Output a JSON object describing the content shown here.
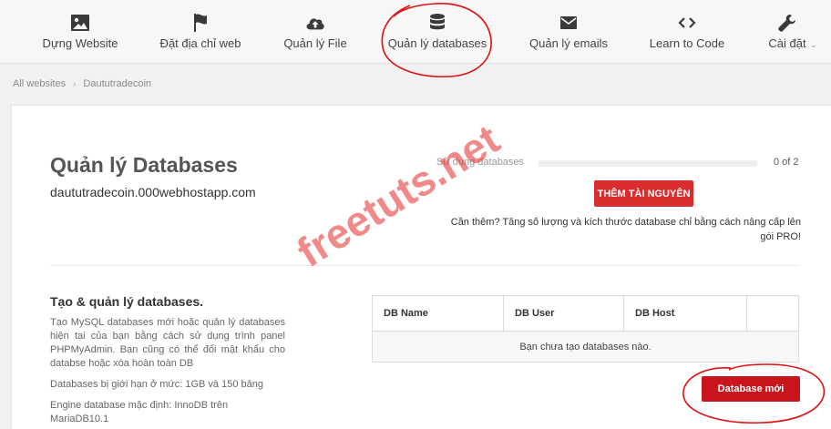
{
  "nav": {
    "items": [
      {
        "label": "Dựng Website",
        "icon": "image-icon"
      },
      {
        "label": "Đặt địa chỉ web",
        "icon": "flag-icon"
      },
      {
        "label": "Quản lý File",
        "icon": "cloud-upload-icon"
      },
      {
        "label": "Quản lý databases",
        "icon": "database-icon"
      },
      {
        "label": "Quản lý emails",
        "icon": "envelope-icon"
      },
      {
        "label": "Learn to Code",
        "icon": "code-icon"
      },
      {
        "label": "Cài đặt",
        "icon": "wrench-icon"
      }
    ],
    "caret": "⌄"
  },
  "breadcrumb": {
    "root": "All websites",
    "separator": "›",
    "current": "Daututradecoin"
  },
  "main": {
    "title": "Quản lý Databases",
    "site": "daututradecoin.000webhostapp.com",
    "usage_label": "Sử dụng databases",
    "usage_count": "0 of 2",
    "usage_fraction": 0,
    "more_button": "THÊM TÀI NGUYÊN",
    "upgrade_text": "Cần thêm? Tăng số lượng và kích thước database chỉ bằng cách nâng cấp lên gói PRO!"
  },
  "section": {
    "title": "Tạo & quản lý databases.",
    "desc": "Tạo MySQL databases mới hoặc quản lý databases hiện tại của bạn bằng cách sử dụng trình panel PHPMyAdmin. Bạn cũng có thể đổi mật khẩu cho databse hoặc xóa hoàn toàn DB",
    "limit": "Databases bị giới hạn ở mức: 1GB và 150 bảng",
    "engine": "Engine database mặc định: InnoDB trên MariaDB10.1"
  },
  "table": {
    "columns": [
      "DB Name",
      "DB User",
      "DB Host",
      ""
    ],
    "empty": "Bạn chưa tạo databases nào."
  },
  "new_db_button": "Database mới",
  "watermark": "freetuts.net",
  "colors": {
    "accent": "#d92c2c",
    "annotation": "#e01010"
  }
}
